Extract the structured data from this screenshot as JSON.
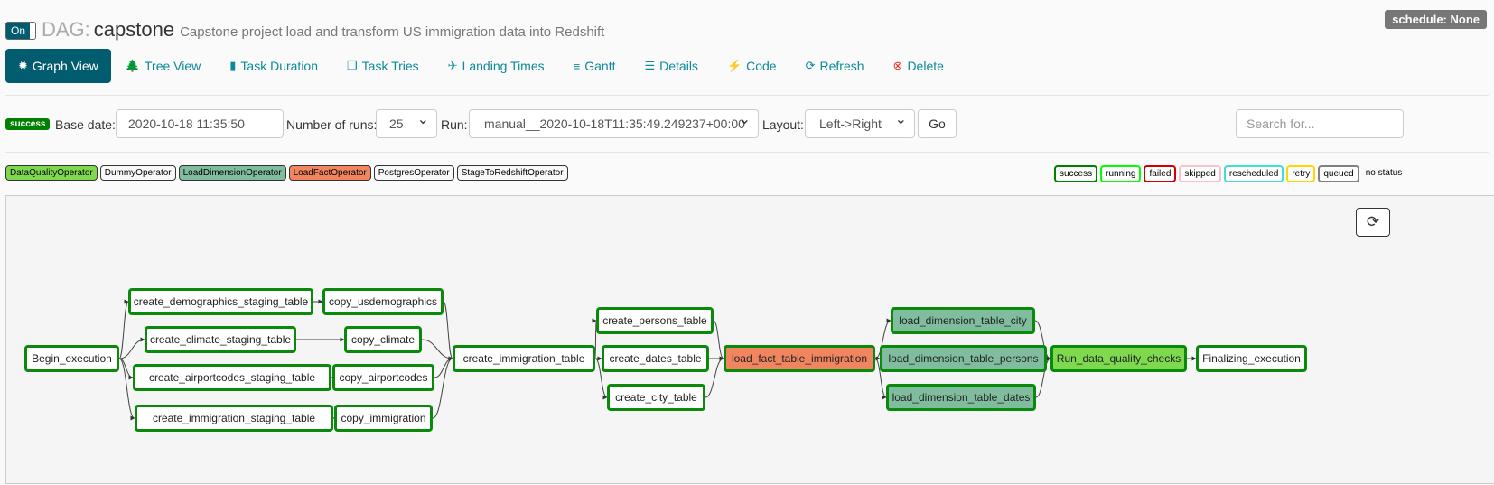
{
  "header": {
    "toggle_label": "On",
    "dag_label": "DAG:",
    "dag_id": "capstone",
    "description": "Capstone project load and transform US immigration data into Redshift",
    "schedule": "schedule: None"
  },
  "nav": [
    {
      "label": "Graph View",
      "icon": "sunburst-icon",
      "glyph": "✹",
      "active": true
    },
    {
      "label": "Tree View",
      "icon": "tree-icon",
      "glyph": "🌲"
    },
    {
      "label": "Task Duration",
      "icon": "bar-chart-icon",
      "glyph": "▮"
    },
    {
      "label": "Task Tries",
      "icon": "duplicate-icon",
      "glyph": "❐"
    },
    {
      "label": "Landing Times",
      "icon": "plane-icon",
      "glyph": "✈"
    },
    {
      "label": "Gantt",
      "icon": "gantt-icon",
      "glyph": "≡"
    },
    {
      "label": "Details",
      "icon": "list-icon",
      "glyph": "☰"
    },
    {
      "label": "Code",
      "icon": "flash-icon",
      "glyph": "⚡"
    },
    {
      "label": "Refresh",
      "icon": "refresh-icon",
      "glyph": "⟳"
    },
    {
      "label": "Delete",
      "icon": "delete-icon",
      "glyph": "⊗",
      "color": "#d9342b"
    }
  ],
  "form": {
    "state_badge": "success",
    "base_date_label": "Base date:",
    "base_date_value": "2020-10-18 11:35:50",
    "num_runs_label": "Number of runs:",
    "num_runs_value": "25",
    "run_label": "Run:",
    "run_value": "manual__2020-10-18T11:35:49.249237+00:00",
    "layout_label": "Layout:",
    "layout_value": "Left->Right",
    "go_label": "Go",
    "search_placeholder": "Search for..."
  },
  "operators": [
    {
      "name": "DataQualityOperator",
      "color": "#7fd94e"
    },
    {
      "name": "DummyOperator",
      "color": "#f8f8f8"
    },
    {
      "name": "LoadDimensionOperator",
      "color": "#80bd9e"
    },
    {
      "name": "LoadFactOperator",
      "color": "#f0855f"
    },
    {
      "name": "PostgresOperator",
      "color": "#f8f8f8"
    },
    {
      "name": "StageToRedshiftOperator",
      "color": "#f8f8f8"
    }
  ],
  "statuses": [
    {
      "name": "success",
      "color": "#008000"
    },
    {
      "name": "running",
      "color": "#00ff00"
    },
    {
      "name": "failed",
      "color": "#d00000"
    },
    {
      "name": "skipped",
      "color": "#ffc0cb"
    },
    {
      "name": "rescheduled",
      "color": "#40e0d0"
    },
    {
      "name": "retry",
      "color": "#ffd700"
    },
    {
      "name": "queued",
      "color": "#808080"
    }
  ],
  "no_status_label": "no status",
  "graph": {
    "refresh_icon": "refresh-icon",
    "nodes": [
      {
        "id": "begin",
        "label": "Begin_execution",
        "color": "#ffffff"
      },
      {
        "id": "c_demo",
        "label": "create_demographics_staging_table",
        "color": "#ffffff"
      },
      {
        "id": "c_climate",
        "label": "create_climate_staging_table",
        "color": "#ffffff"
      },
      {
        "id": "c_airport",
        "label": "create_airportcodes_staging_table",
        "color": "#ffffff"
      },
      {
        "id": "c_immig_stg",
        "label": "create_immigration_staging_table",
        "color": "#ffffff"
      },
      {
        "id": "cp_demo",
        "label": "copy_usdemographics",
        "color": "#ffffff"
      },
      {
        "id": "cp_climate",
        "label": "copy_climate",
        "color": "#ffffff"
      },
      {
        "id": "cp_airport",
        "label": "copy_airportcodes",
        "color": "#ffffff"
      },
      {
        "id": "cp_immig",
        "label": "copy_immigration",
        "color": "#ffffff"
      },
      {
        "id": "c_immig",
        "label": "create_immigration_table",
        "color": "#ffffff"
      },
      {
        "id": "c_persons",
        "label": "create_persons_table",
        "color": "#ffffff"
      },
      {
        "id": "c_dates",
        "label": "create_dates_table",
        "color": "#ffffff"
      },
      {
        "id": "c_city",
        "label": "create_city_table",
        "color": "#ffffff"
      },
      {
        "id": "l_fact",
        "label": "load_fact_table_immigration",
        "color": "#f0855f"
      },
      {
        "id": "l_city",
        "label": "load_dimension_table_city",
        "color": "#80bd9e"
      },
      {
        "id": "l_persons",
        "label": "load_dimension_table_persons",
        "color": "#80bd9e"
      },
      {
        "id": "l_dates",
        "label": "load_dimension_table_dates",
        "color": "#80bd9e"
      },
      {
        "id": "dq",
        "label": "Run_data_quality_checks",
        "color": "#7fd94e"
      },
      {
        "id": "final",
        "label": "Finalizing_execution",
        "color": "#ffffff"
      }
    ],
    "edges": [
      [
        "begin",
        "c_demo"
      ],
      [
        "begin",
        "c_climate"
      ],
      [
        "begin",
        "c_airport"
      ],
      [
        "begin",
        "c_immig_stg"
      ],
      [
        "c_demo",
        "cp_demo"
      ],
      [
        "c_climate",
        "cp_climate"
      ],
      [
        "c_airport",
        "cp_airport"
      ],
      [
        "c_immig_stg",
        "cp_immig"
      ],
      [
        "cp_demo",
        "c_immig"
      ],
      [
        "cp_climate",
        "c_immig"
      ],
      [
        "cp_airport",
        "c_immig"
      ],
      [
        "cp_immig",
        "c_immig"
      ],
      [
        "c_immig",
        "c_persons"
      ],
      [
        "c_immig",
        "c_dates"
      ],
      [
        "c_immig",
        "c_city"
      ],
      [
        "c_persons",
        "l_fact"
      ],
      [
        "c_dates",
        "l_fact"
      ],
      [
        "c_city",
        "l_fact"
      ],
      [
        "l_fact",
        "l_city"
      ],
      [
        "l_fact",
        "l_persons"
      ],
      [
        "l_fact",
        "l_dates"
      ],
      [
        "l_city",
        "dq"
      ],
      [
        "l_persons",
        "dq"
      ],
      [
        "l_dates",
        "dq"
      ],
      [
        "dq",
        "final"
      ]
    ]
  }
}
